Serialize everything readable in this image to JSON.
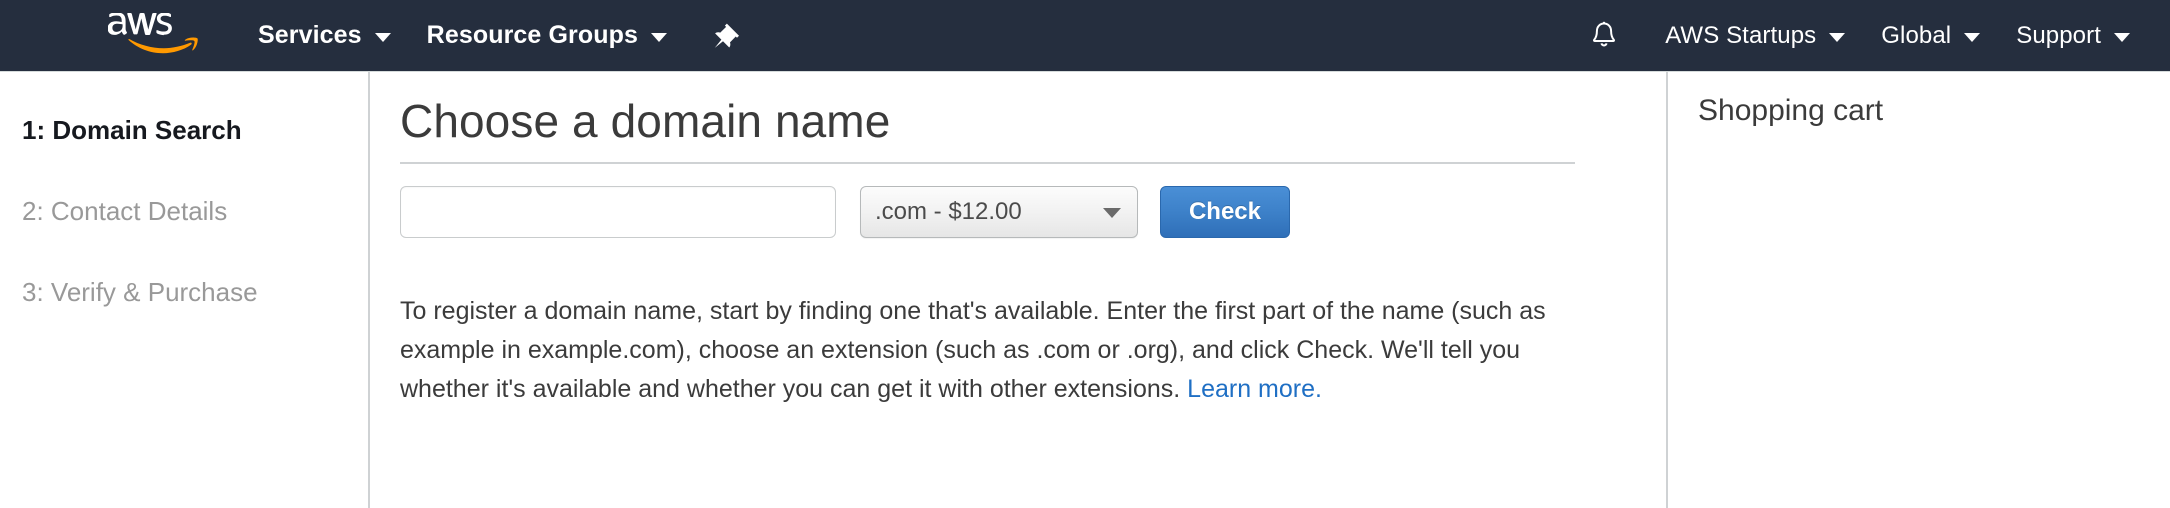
{
  "topnav": {
    "logo_alt": "aws",
    "left_items": [
      {
        "label": "Services",
        "has_caret": true
      },
      {
        "label": "Resource Groups",
        "has_caret": true
      }
    ],
    "pin_icon": "pushpin-icon",
    "bell_icon": "bell-icon",
    "right_items": [
      {
        "label": "AWS Startups",
        "has_caret": true
      },
      {
        "label": "Global",
        "has_caret": true
      },
      {
        "label": "Support",
        "has_caret": true
      }
    ],
    "background_color": "#252e3e"
  },
  "steps": [
    {
      "label": "1: Domain Search",
      "active": true
    },
    {
      "label": "2: Contact Details",
      "active": false
    },
    {
      "label": "3: Verify & Purchase",
      "active": false
    }
  ],
  "main": {
    "title": "Choose a domain name",
    "search": {
      "domain_value": "",
      "domain_placeholder": "",
      "tld_selected": ".com - $12.00",
      "check_label": "Check"
    },
    "help_text_part1": "To register a domain name, start by finding one that's available. Enter the first part of the name (such as example in example.com), choose an extension (such as .com or .org), and click Check. We'll tell you whether it's available and whether you can get it with other extensions. ",
    "learn_more_label": "Learn more.",
    "link_color": "#1f6fc4"
  },
  "cart": {
    "title": "Shopping cart"
  }
}
